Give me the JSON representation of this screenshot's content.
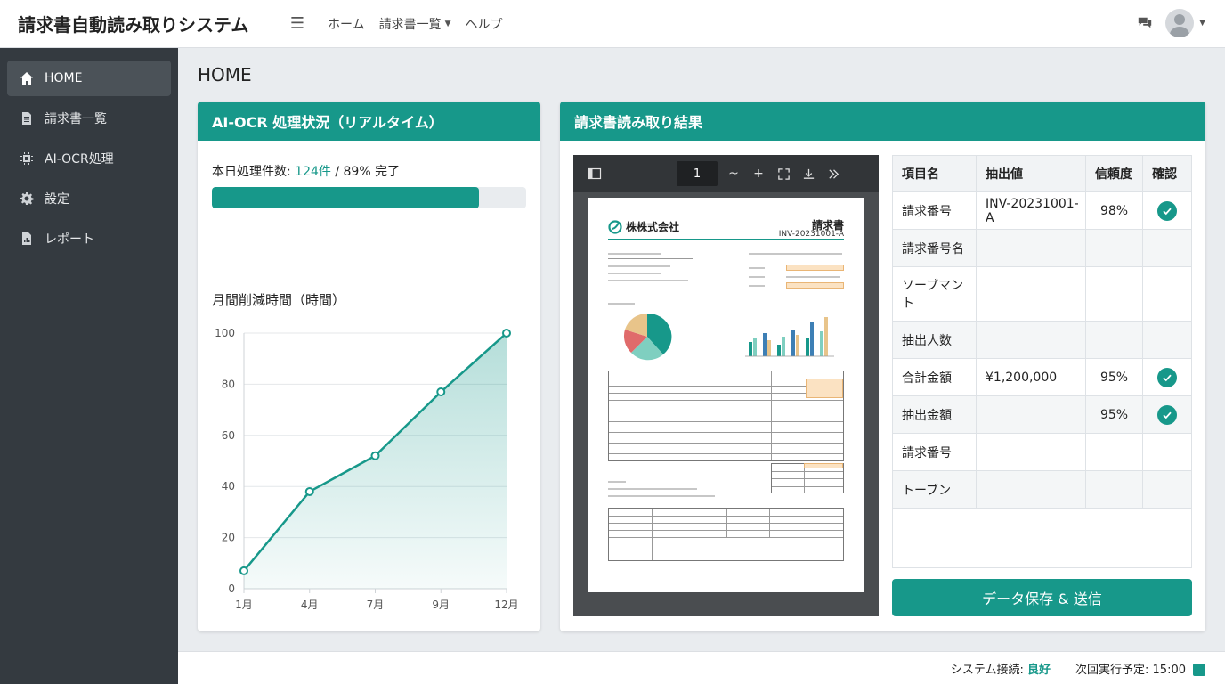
{
  "app": {
    "title": "請求書自動読み取りシステム"
  },
  "topnav": {
    "items": [
      {
        "label": "ホーム"
      },
      {
        "label": "請求書一覧",
        "has_dropdown": true
      },
      {
        "label": "ヘルプ"
      }
    ]
  },
  "sidebar": {
    "items": [
      {
        "label": "HOME",
        "icon": "home-icon",
        "active": true
      },
      {
        "label": "請求書一覧",
        "icon": "document-icon"
      },
      {
        "label": "AI-OCR処理",
        "icon": "chip-icon"
      },
      {
        "label": "設定",
        "icon": "gear-icon"
      },
      {
        "label": "レポート",
        "icon": "report-icon"
      }
    ]
  },
  "page": {
    "title": "HOME"
  },
  "ocr_status": {
    "header": "AI-OCR 処理状況（リアルタイム）",
    "count_label": "本日処理件数: ",
    "count_value": "124件",
    "percent_text": " / 89% 完了",
    "progress": 0.85
  },
  "savings": {
    "title": "月間削減時間（時間）"
  },
  "chart_data": {
    "type": "area",
    "x": [
      "1月",
      "4月",
      "7月",
      "9月",
      "12月"
    ],
    "series": [
      {
        "values": [
          7,
          38,
          52,
          77,
          100
        ]
      }
    ],
    "xlabel": "",
    "ylabel": "",
    "ylim": [
      0,
      100
    ],
    "yticks": [
      "0",
      "20",
      "40",
      "60",
      "80",
      "100"
    ],
    "grid": true,
    "color": "#17988a"
  },
  "results": {
    "header": "請求書読み取り結果",
    "viewer": {
      "page_number": "1",
      "zoom_out": "~",
      "zoom_in": "+",
      "company": "株株式会社",
      "doc_title": "請求書",
      "invoice_no": "INV-20231001-A"
    },
    "columns": [
      "項目名",
      "抽出値",
      "信頼度",
      "確認"
    ],
    "rows": [
      {
        "item": "請求番号",
        "value": "INV-20231001-A",
        "confidence": "98%",
        "checked": true
      },
      {
        "item": "請求番号名",
        "value": "",
        "confidence": "",
        "checked": false
      },
      {
        "item": "ソーブマント",
        "value": "",
        "confidence": "",
        "checked": false
      },
      {
        "item": "抽出人数",
        "value": "",
        "confidence": "",
        "checked": false
      },
      {
        "item": "合計金額",
        "value": "¥1,200,000",
        "confidence": "95%",
        "checked": true
      },
      {
        "item": "抽出金額",
        "value": "",
        "confidence": "95%",
        "checked": true
      },
      {
        "item": "請求番号",
        "value": "",
        "confidence": "",
        "checked": false
      },
      {
        "item": "トーブン",
        "value": "",
        "confidence": "",
        "checked": false
      }
    ],
    "save_label": "データ保存 & 送信"
  },
  "footer": {
    "connection_label": "システム接続: ",
    "connection_status": "良好",
    "next_run": "次回実行予定: 15:00"
  },
  "colors": {
    "accent": "#17988a",
    "sidebar": "#343a40"
  }
}
